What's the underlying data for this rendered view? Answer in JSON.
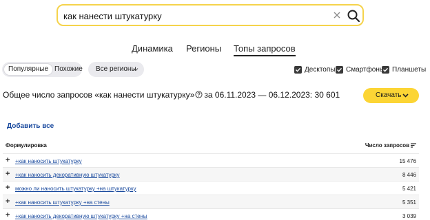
{
  "search": {
    "value": "как нанести штукатурку"
  },
  "tabs": [
    {
      "label": "Динамика",
      "active": false
    },
    {
      "label": "Регионы",
      "active": false
    },
    {
      "label": "Топы запросов",
      "active": true
    }
  ],
  "filters": {
    "popular": "Популярные",
    "similar": "Похожие",
    "regions": "Все регионы",
    "devices": [
      {
        "label": "Десктопы",
        "checked": true
      },
      {
        "label": "Смартфоны",
        "checked": true
      },
      {
        "label": "Планшеты",
        "checked": true
      }
    ]
  },
  "summary": {
    "prefix": "Общее число запросов «как нанести штукатурку»",
    "suffix": "за 06.11.2023 — 06.12.2023: 30 601"
  },
  "download_label": "Скачать",
  "add_all_label": "Добавить все",
  "table": {
    "col_phrase": "Формулировка",
    "col_count": "Число запросов",
    "rows": [
      {
        "phrase": "+как наносить штукатурку",
        "count": "15 476"
      },
      {
        "phrase": "+как наносить декоративную штукатурку",
        "count": "8 446"
      },
      {
        "phrase": "можно ли наносить штукатурку +на штукатурку",
        "count": "5 421"
      },
      {
        "phrase": "+как наносить штукатурку +на стены",
        "count": "5 351"
      },
      {
        "phrase": "+как наносить декоративную штукатурку +на стены",
        "count": "3 039"
      }
    ]
  },
  "colors": {
    "accent": "#fcd535",
    "search_border": "#f5d34b",
    "link": "#1a4a9e"
  }
}
